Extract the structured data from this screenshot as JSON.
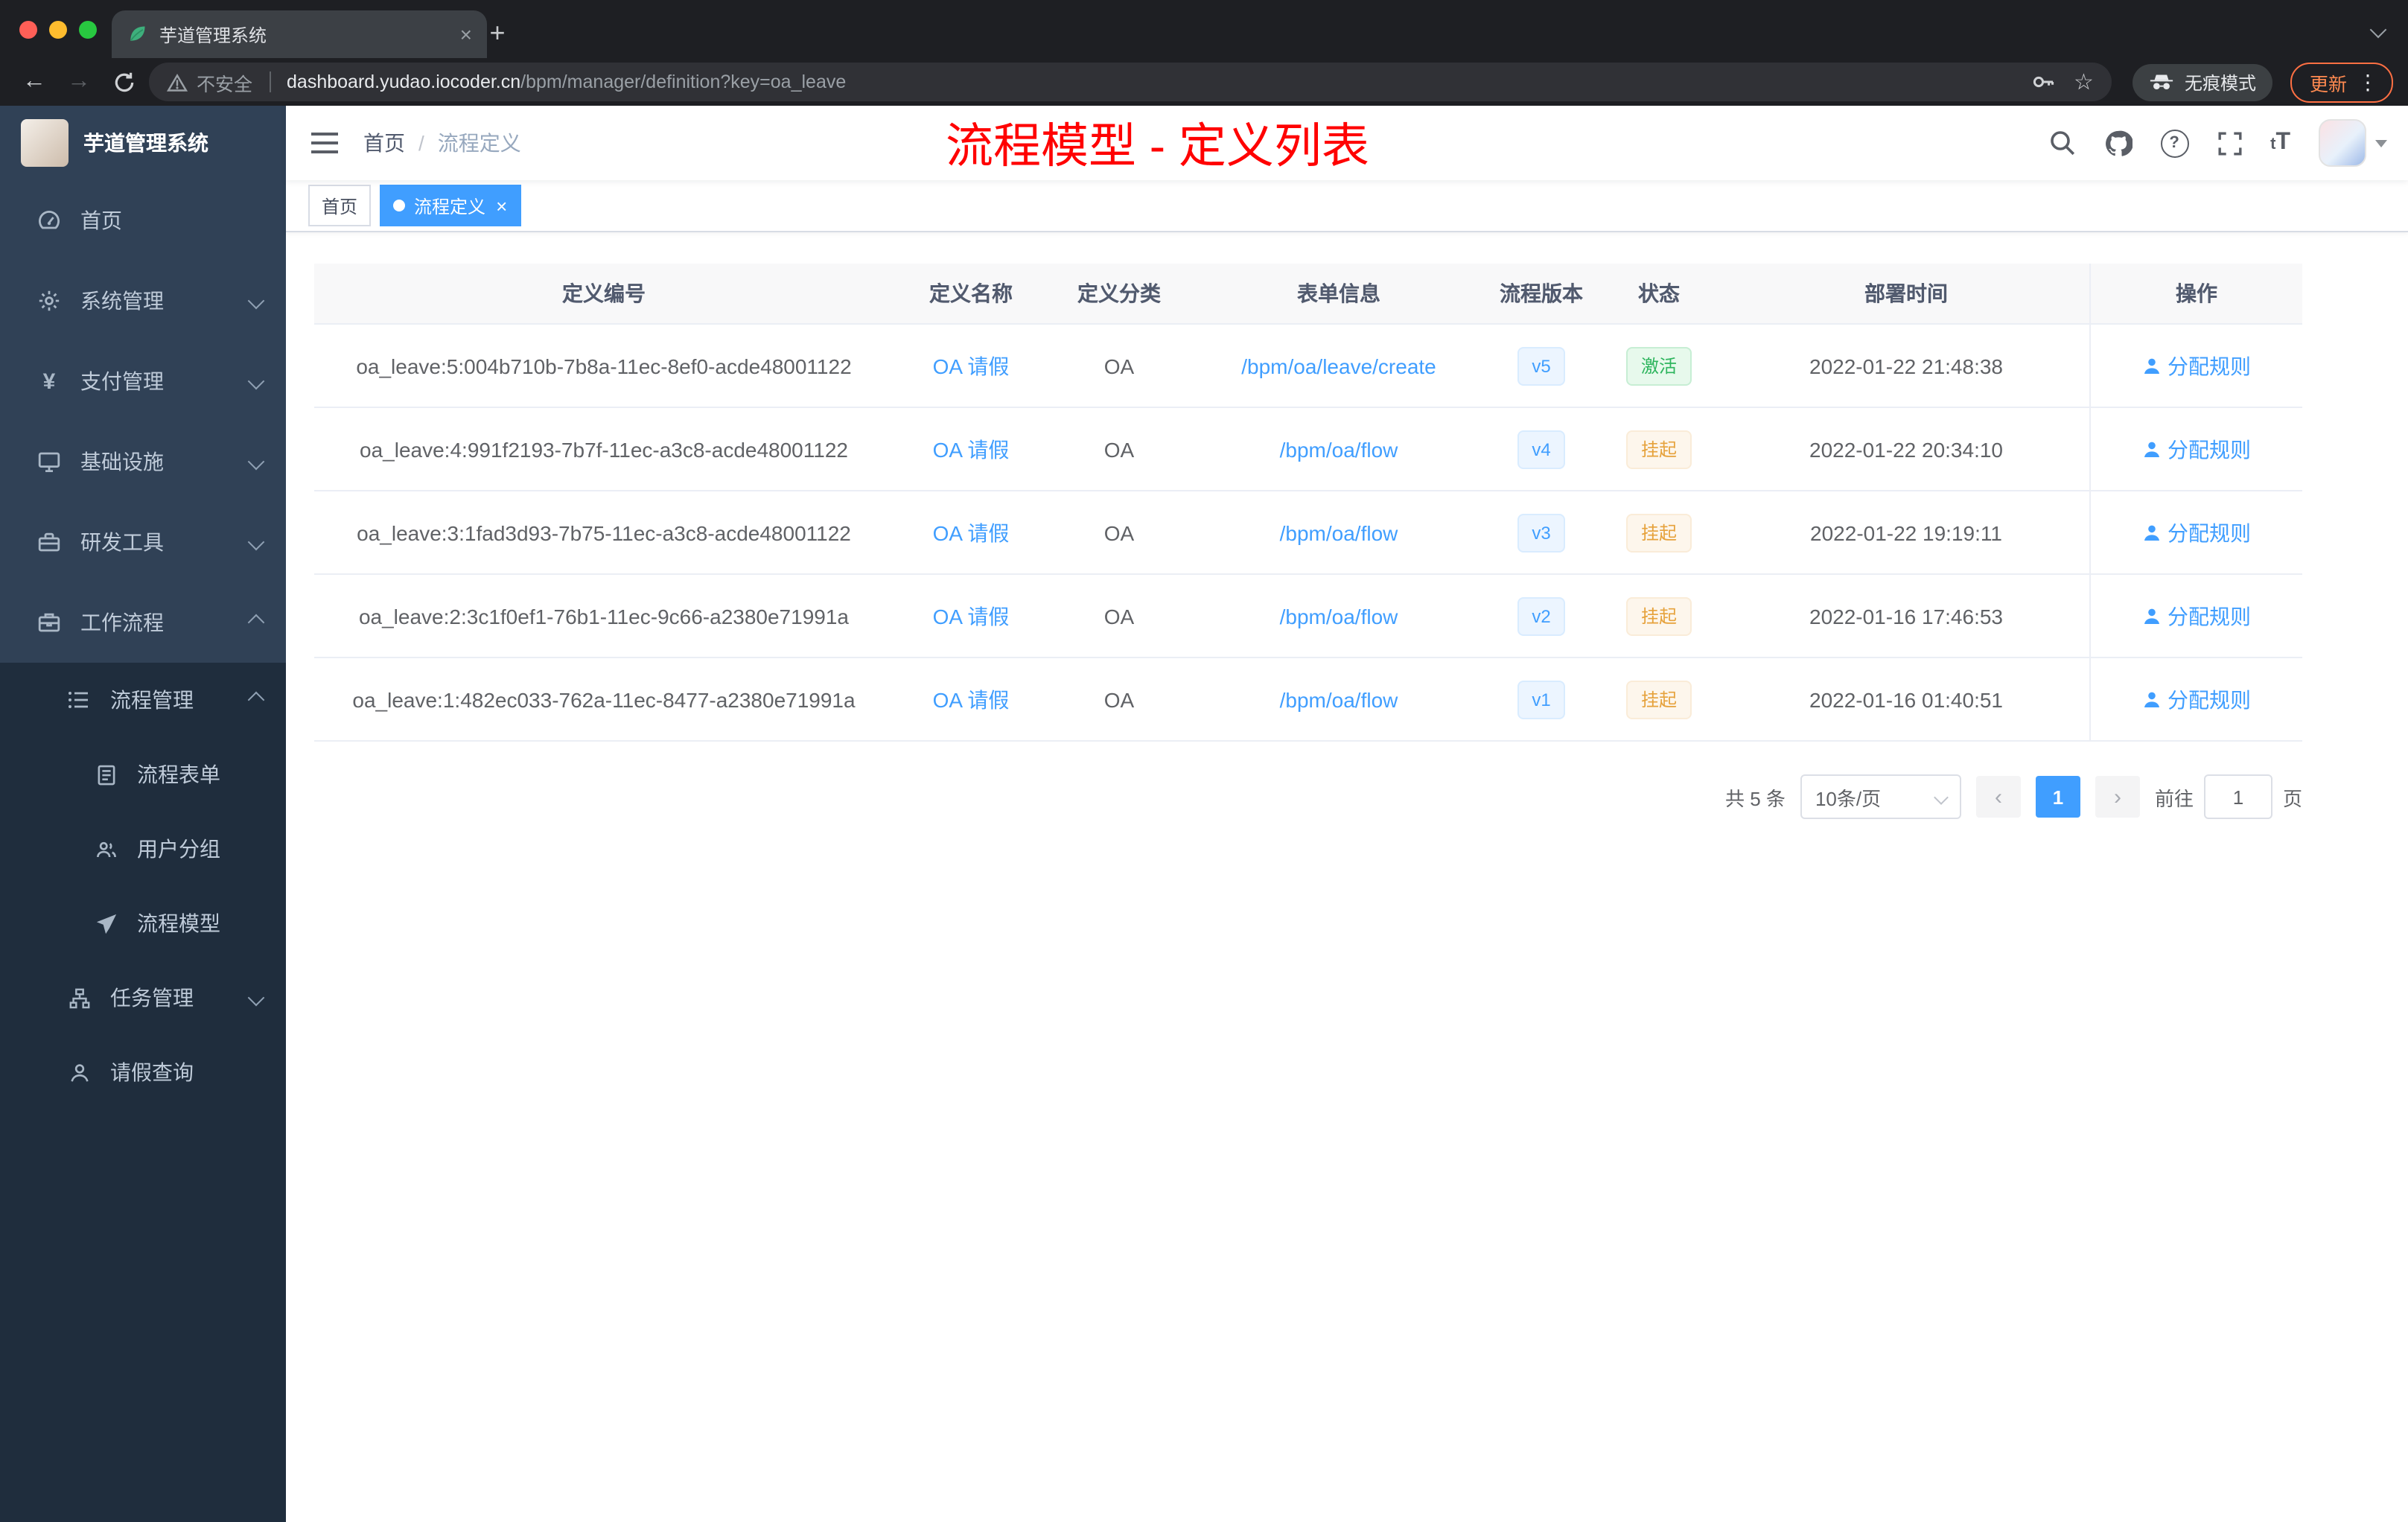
{
  "colors": {
    "accent": "#409EFF",
    "annotation_red": "#FF0000",
    "sidebar_bg": "#304156",
    "submenu_bg": "#1F2D3D",
    "success_text": "#2DB55D",
    "warning_text": "#E6A23C",
    "link": "#409EFF"
  },
  "glyphs": {
    "close": "×",
    "plus": "+",
    "kebab": "⋮",
    "back": "←",
    "forward": "→",
    "star": "☆",
    "prev": "‹",
    "next": "›",
    "question": "?",
    "font_small": "t",
    "font_large": "T",
    "yen": "¥"
  },
  "browser": {
    "tab_title": "芋道管理系统",
    "security_label": "不安全",
    "url_host": "dashboard.yudao.iocoder.cn",
    "url_path": "/bpm/manager/definition?key=oa_leave",
    "incognito_label": "无痕模式",
    "update_label": "更新"
  },
  "sidebar": {
    "app_title": "芋道管理系统",
    "items": [
      {
        "label": "首页"
      },
      {
        "label": "系统管理"
      },
      {
        "label": "支付管理"
      },
      {
        "label": "基础设施"
      },
      {
        "label": "研发工具"
      },
      {
        "label": "工作流程"
      },
      {
        "label": "流程管理"
      },
      {
        "label": "流程表单"
      },
      {
        "label": "用户分组"
      },
      {
        "label": "流程模型"
      },
      {
        "label": "任务管理"
      },
      {
        "label": "请假查询"
      }
    ]
  },
  "header": {
    "breadcrumb_home": "首页",
    "breadcrumb_sep": "/",
    "breadcrumb_current": "流程定义",
    "annotation": "流程模型 - 定义列表"
  },
  "tags": {
    "home": "首页",
    "active": "流程定义"
  },
  "table": {
    "columns": {
      "id": "定义编号",
      "name": "定义名称",
      "category": "定义分类",
      "form": "表单信息",
      "version": "流程版本",
      "status": "状态",
      "deploy_time": "部署时间",
      "actions": "操作"
    },
    "action_label": "分配规则",
    "rows": [
      {
        "id": "oa_leave:5:004b710b-7b8a-11ec-8ef0-acde48001122",
        "name": "OA 请假",
        "category": "OA",
        "form": "/bpm/oa/leave/create",
        "version": "v5",
        "status": "激活",
        "status_type": "success",
        "deploy_time": "2022-01-22 21:48:38"
      },
      {
        "id": "oa_leave:4:991f2193-7b7f-11ec-a3c8-acde48001122",
        "name": "OA 请假",
        "category": "OA",
        "form": "/bpm/oa/flow",
        "version": "v4",
        "status": "挂起",
        "status_type": "warning",
        "deploy_time": "2022-01-22 20:34:10"
      },
      {
        "id": "oa_leave:3:1fad3d93-7b75-11ec-a3c8-acde48001122",
        "name": "OA 请假",
        "category": "OA",
        "form": "/bpm/oa/flow",
        "version": "v3",
        "status": "挂起",
        "status_type": "warning",
        "deploy_time": "2022-01-22 19:19:11"
      },
      {
        "id": "oa_leave:2:3c1f0ef1-76b1-11ec-9c66-a2380e71991a",
        "name": "OA 请假",
        "category": "OA",
        "form": "/bpm/oa/flow",
        "version": "v2",
        "status": "挂起",
        "status_type": "warning",
        "deploy_time": "2022-01-16 17:46:53"
      },
      {
        "id": "oa_leave:1:482ec033-762a-11ec-8477-a2380e71991a",
        "name": "OA 请假",
        "category": "OA",
        "form": "/bpm/oa/flow",
        "version": "v1",
        "status": "挂起",
        "status_type": "warning",
        "deploy_time": "2022-01-16 01:40:51"
      }
    ]
  },
  "pagination": {
    "total": "共 5 条",
    "page_size": "10条/页",
    "page": "1",
    "goto_label": "前往",
    "goto_value": "1",
    "page_unit": "页"
  }
}
